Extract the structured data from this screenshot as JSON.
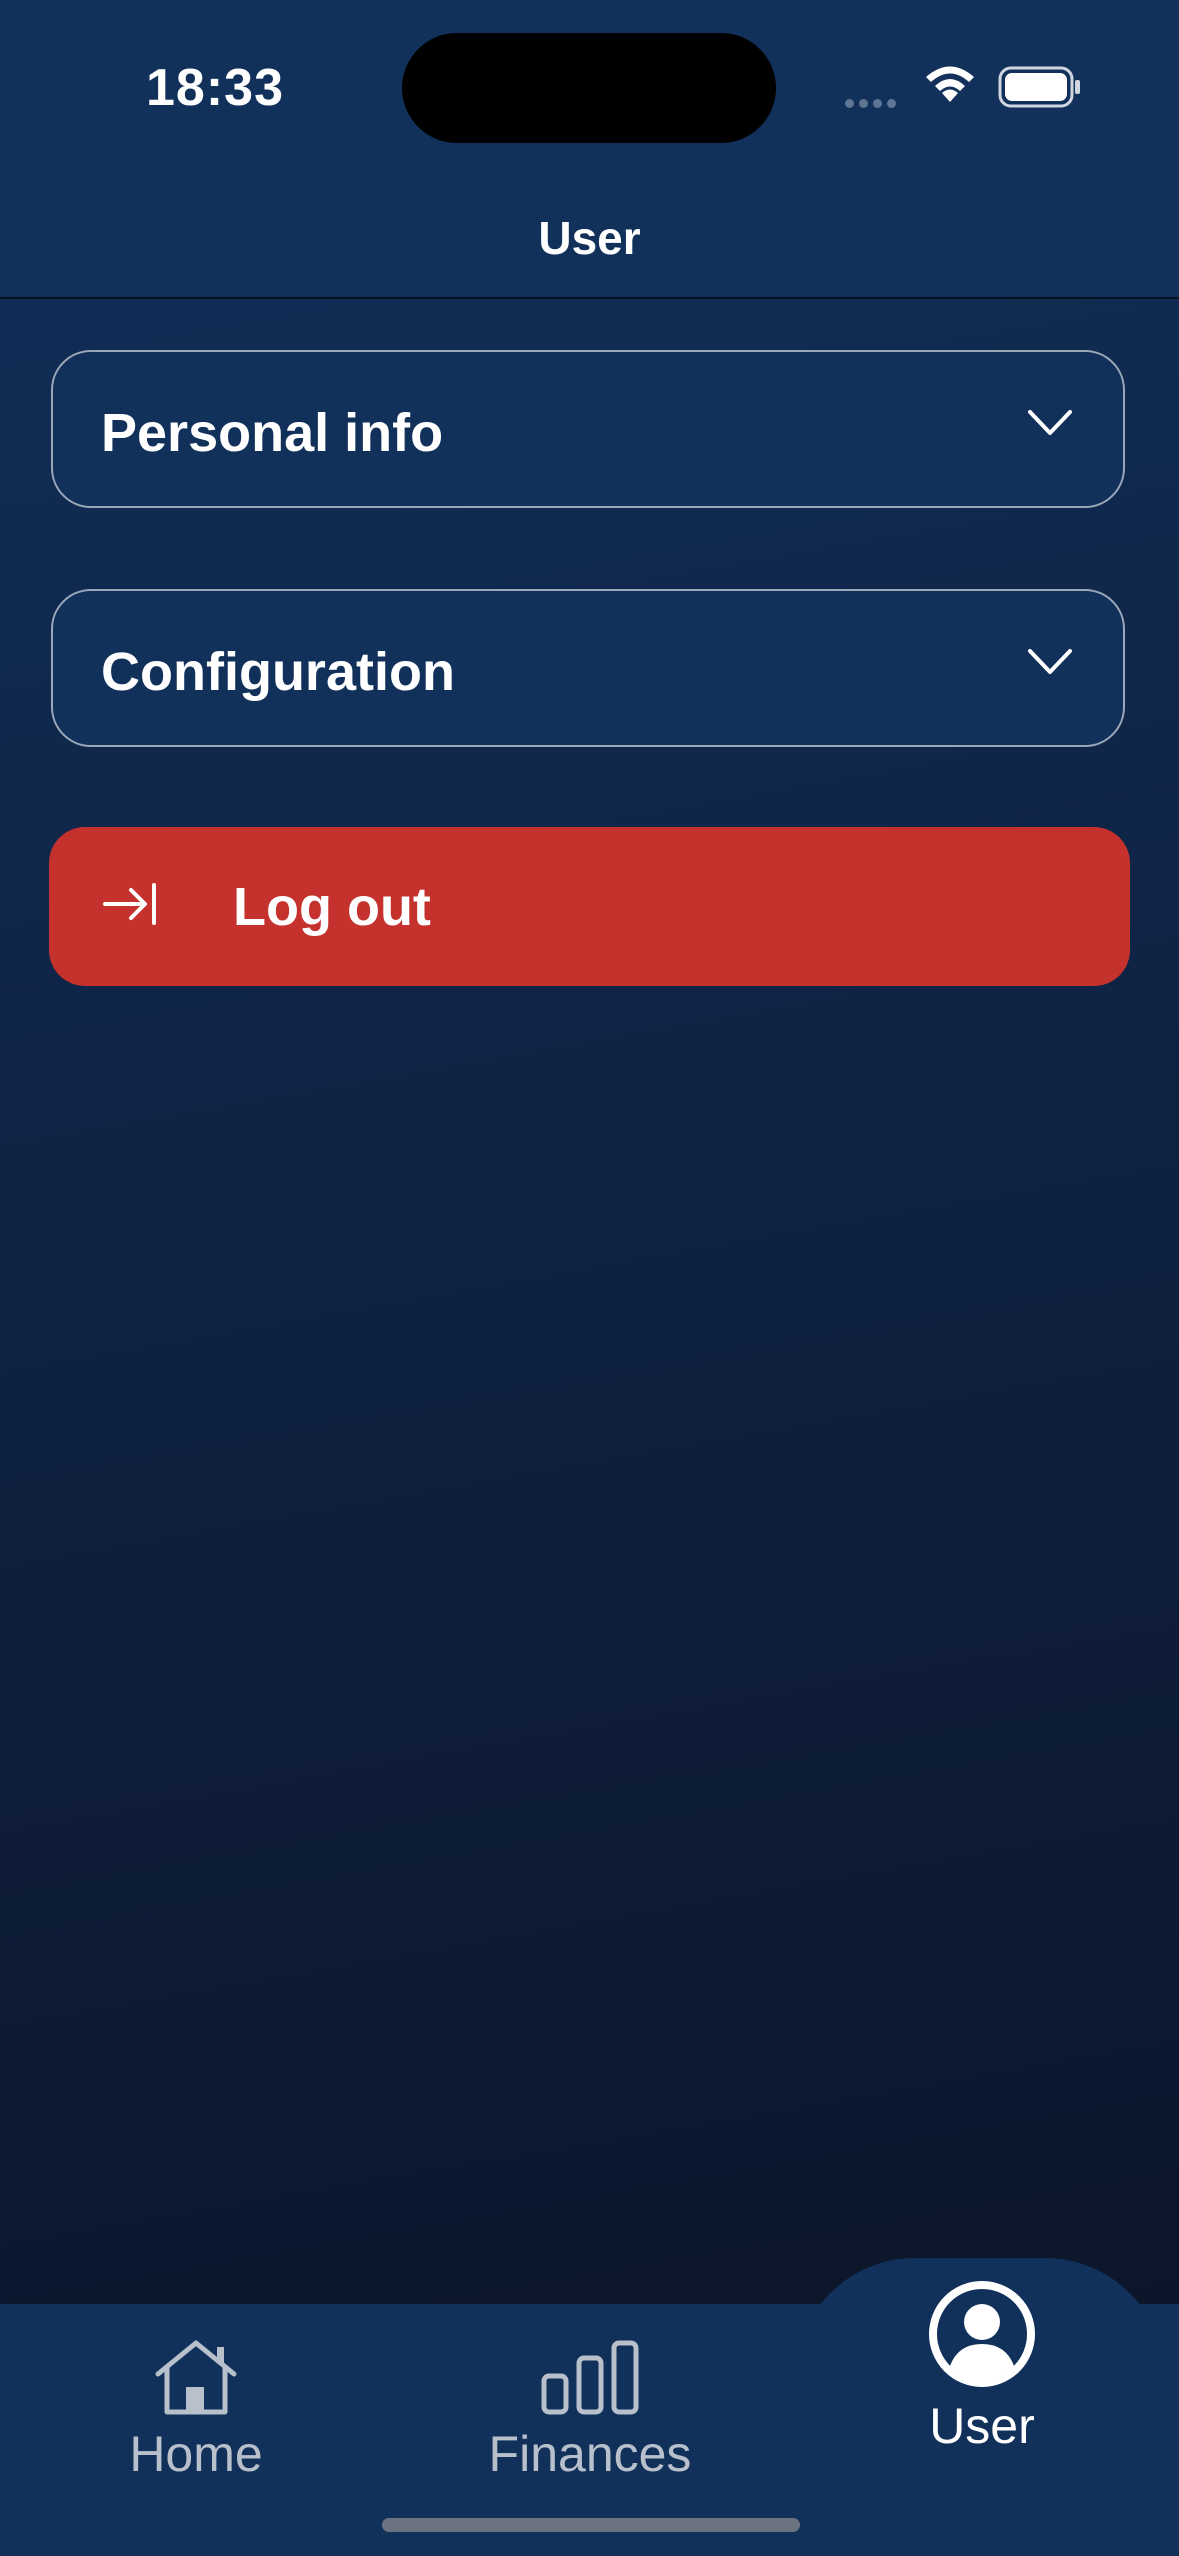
{
  "status_bar": {
    "time": "18:33"
  },
  "header": {
    "title": "User"
  },
  "sections": [
    {
      "label": "Personal info",
      "icon": "chevron-down-icon"
    },
    {
      "label": "Configuration",
      "icon": "chevron-down-icon"
    }
  ],
  "logout": {
    "label": "Log out",
    "icon": "logout-arrow-icon",
    "color": "#c5322d"
  },
  "tabs": [
    {
      "label": "Home",
      "icon": "home-icon",
      "active": false
    },
    {
      "label": "Finances",
      "icon": "bar-chart-icon",
      "active": false
    },
    {
      "label": "User",
      "icon": "user-circle-icon",
      "active": true
    }
  ],
  "colors": {
    "background": "#0f2446",
    "bar": "#11305a",
    "accent": "#c5322d"
  }
}
